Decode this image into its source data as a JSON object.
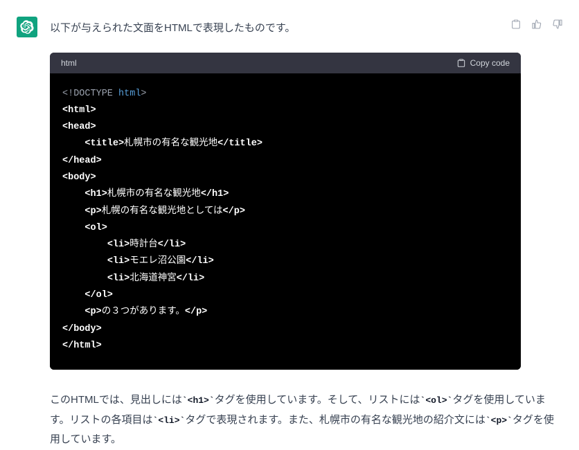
{
  "intro": "以下が与えられた文面をHTMLで表現したものです。",
  "code": {
    "lang": "html",
    "copy_label": "Copy code",
    "lines": {
      "l1": {
        "prefix": "<!DOCTYPE ",
        "kw": "html",
        "suffix": ">"
      },
      "l2": {
        "open": "<html>"
      },
      "l3": {
        "open": "<head>"
      },
      "l4": {
        "indent": "    ",
        "open": "<title>",
        "text": "札幌市の有名な観光地",
        "close": "</title>"
      },
      "l5": {
        "open": "</head>"
      },
      "l6": {
        "open": "<body>"
      },
      "l7": {
        "indent": "    ",
        "open": "<h1>",
        "text": "札幌市の有名な観光地",
        "close": "</h1>"
      },
      "l8": {
        "indent": "    ",
        "open": "<p>",
        "text": "札幌の有名な観光地としては",
        "close": "</p>"
      },
      "l9": {
        "indent": "    ",
        "open": "<ol>"
      },
      "l10": {
        "indent": "        ",
        "open": "<li>",
        "text": "時計台",
        "close": "</li>"
      },
      "l11": {
        "indent": "        ",
        "open": "<li>",
        "text": "モエレ沼公園",
        "close": "</li>"
      },
      "l12": {
        "indent": "        ",
        "open": "<li>",
        "text": "北海道神宮",
        "close": "</li>"
      },
      "l13": {
        "indent": "    ",
        "open": "</ol>"
      },
      "l14": {
        "indent": "    ",
        "open": "<p>",
        "text": "の３つがあります。",
        "close": "</p>"
      },
      "l15": {
        "open": "</body>"
      },
      "l16": {
        "open": "</html>"
      }
    }
  },
  "explanation": {
    "p1_a": "このHTMLでは、見出しには",
    "c1": "`<h1>`",
    "p1_b": "タグを使用しています。そして、リストには",
    "c2": "`<ol>`",
    "p1_c": "タグを使用しています。リストの各項目は",
    "c3": "`<li>`",
    "p1_d": "タグで表現されます。また、札幌市の有名な観光地の紹介文には",
    "c4": "`<p>`",
    "p1_e": "タグを使用しています。"
  }
}
